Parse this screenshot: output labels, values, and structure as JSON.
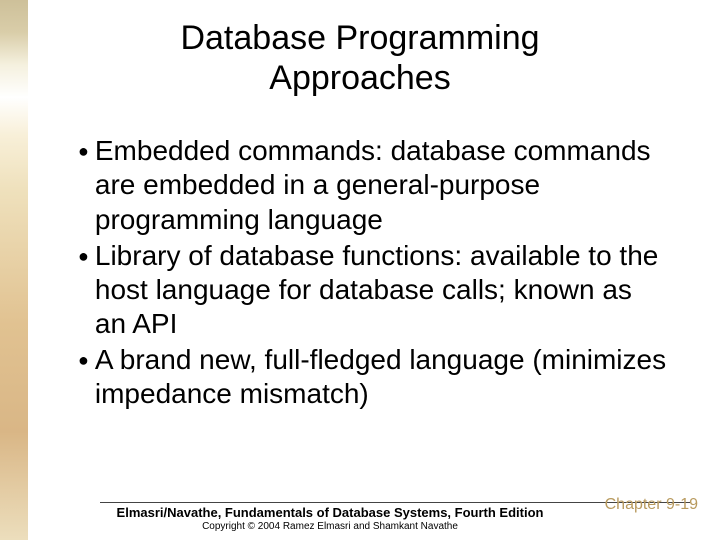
{
  "title": "Database Programming Approaches",
  "bullets": [
    "Embedded commands: database commands are embedded in a general-purpose programming language",
    "Library of database functions: available to the host language for database calls; known as an API",
    "A brand new, full-fledged language (minimizes impedance mismatch)"
  ],
  "footer": {
    "book": "Elmasri/Navathe, Fundamentals of Database Systems, Fourth Edition",
    "copyright": "Copyright © 2004 Ramez Elmasri and Shamkant Navathe",
    "chapter": "Chapter 9-19"
  }
}
